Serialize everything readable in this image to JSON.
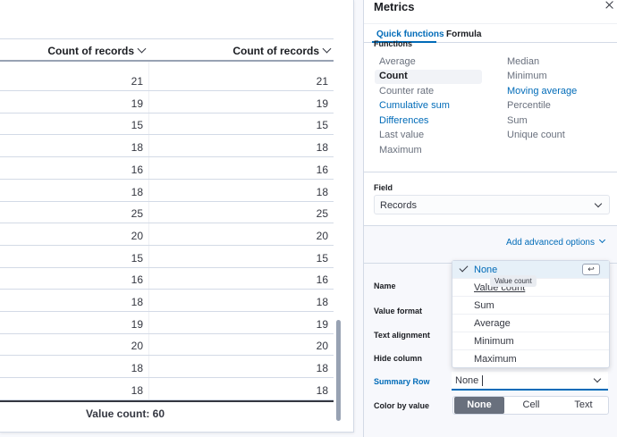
{
  "table": {
    "col1_header": "Count of records",
    "col2_header": "Count of records",
    "rows": [
      [
        "21",
        "21"
      ],
      [
        "19",
        "19"
      ],
      [
        "15",
        "15"
      ],
      [
        "18",
        "18"
      ],
      [
        "16",
        "16"
      ],
      [
        "18",
        "18"
      ],
      [
        "25",
        "25"
      ],
      [
        "20",
        "20"
      ],
      [
        "15",
        "15"
      ],
      [
        "16",
        "16"
      ],
      [
        "18",
        "18"
      ],
      [
        "19",
        "19"
      ],
      [
        "20",
        "20"
      ],
      [
        "18",
        "18"
      ],
      [
        "18",
        "18"
      ]
    ],
    "summary": "Value count: 60"
  },
  "flyout": {
    "title": "Metrics",
    "tabs": {
      "quick": "Quick functions",
      "formula": "Formula"
    },
    "functions_header": "Functions",
    "functions_left": [
      "Average",
      "Count",
      "Counter rate",
      "Cumulative sum",
      "Differences",
      "Last value",
      "Maximum"
    ],
    "functions_right": [
      "Median",
      "Minimum",
      "Moving average",
      "Percentile",
      "Sum",
      "Unique count"
    ],
    "field_label": "Field",
    "field_value": "Records",
    "advanced_link": "Add advanced options",
    "options": {
      "name": "Name",
      "value_format": "Value format",
      "text_alignment": "Text alignment",
      "hide_column": "Hide column",
      "summary_row": "Summary Row",
      "color_by_value": "Color by value"
    },
    "summary_value": "None",
    "color_buttons": [
      "None",
      "Cell",
      "Text"
    ]
  },
  "dropdown": {
    "items": [
      "None",
      "Value count",
      "Sum",
      "Average",
      "Minimum",
      "Maximum"
    ],
    "return_glyph": "↩",
    "tooltip": "Value count"
  },
  "colors": {
    "accent": "#006bb8",
    "selected_btn": "#69707d"
  }
}
